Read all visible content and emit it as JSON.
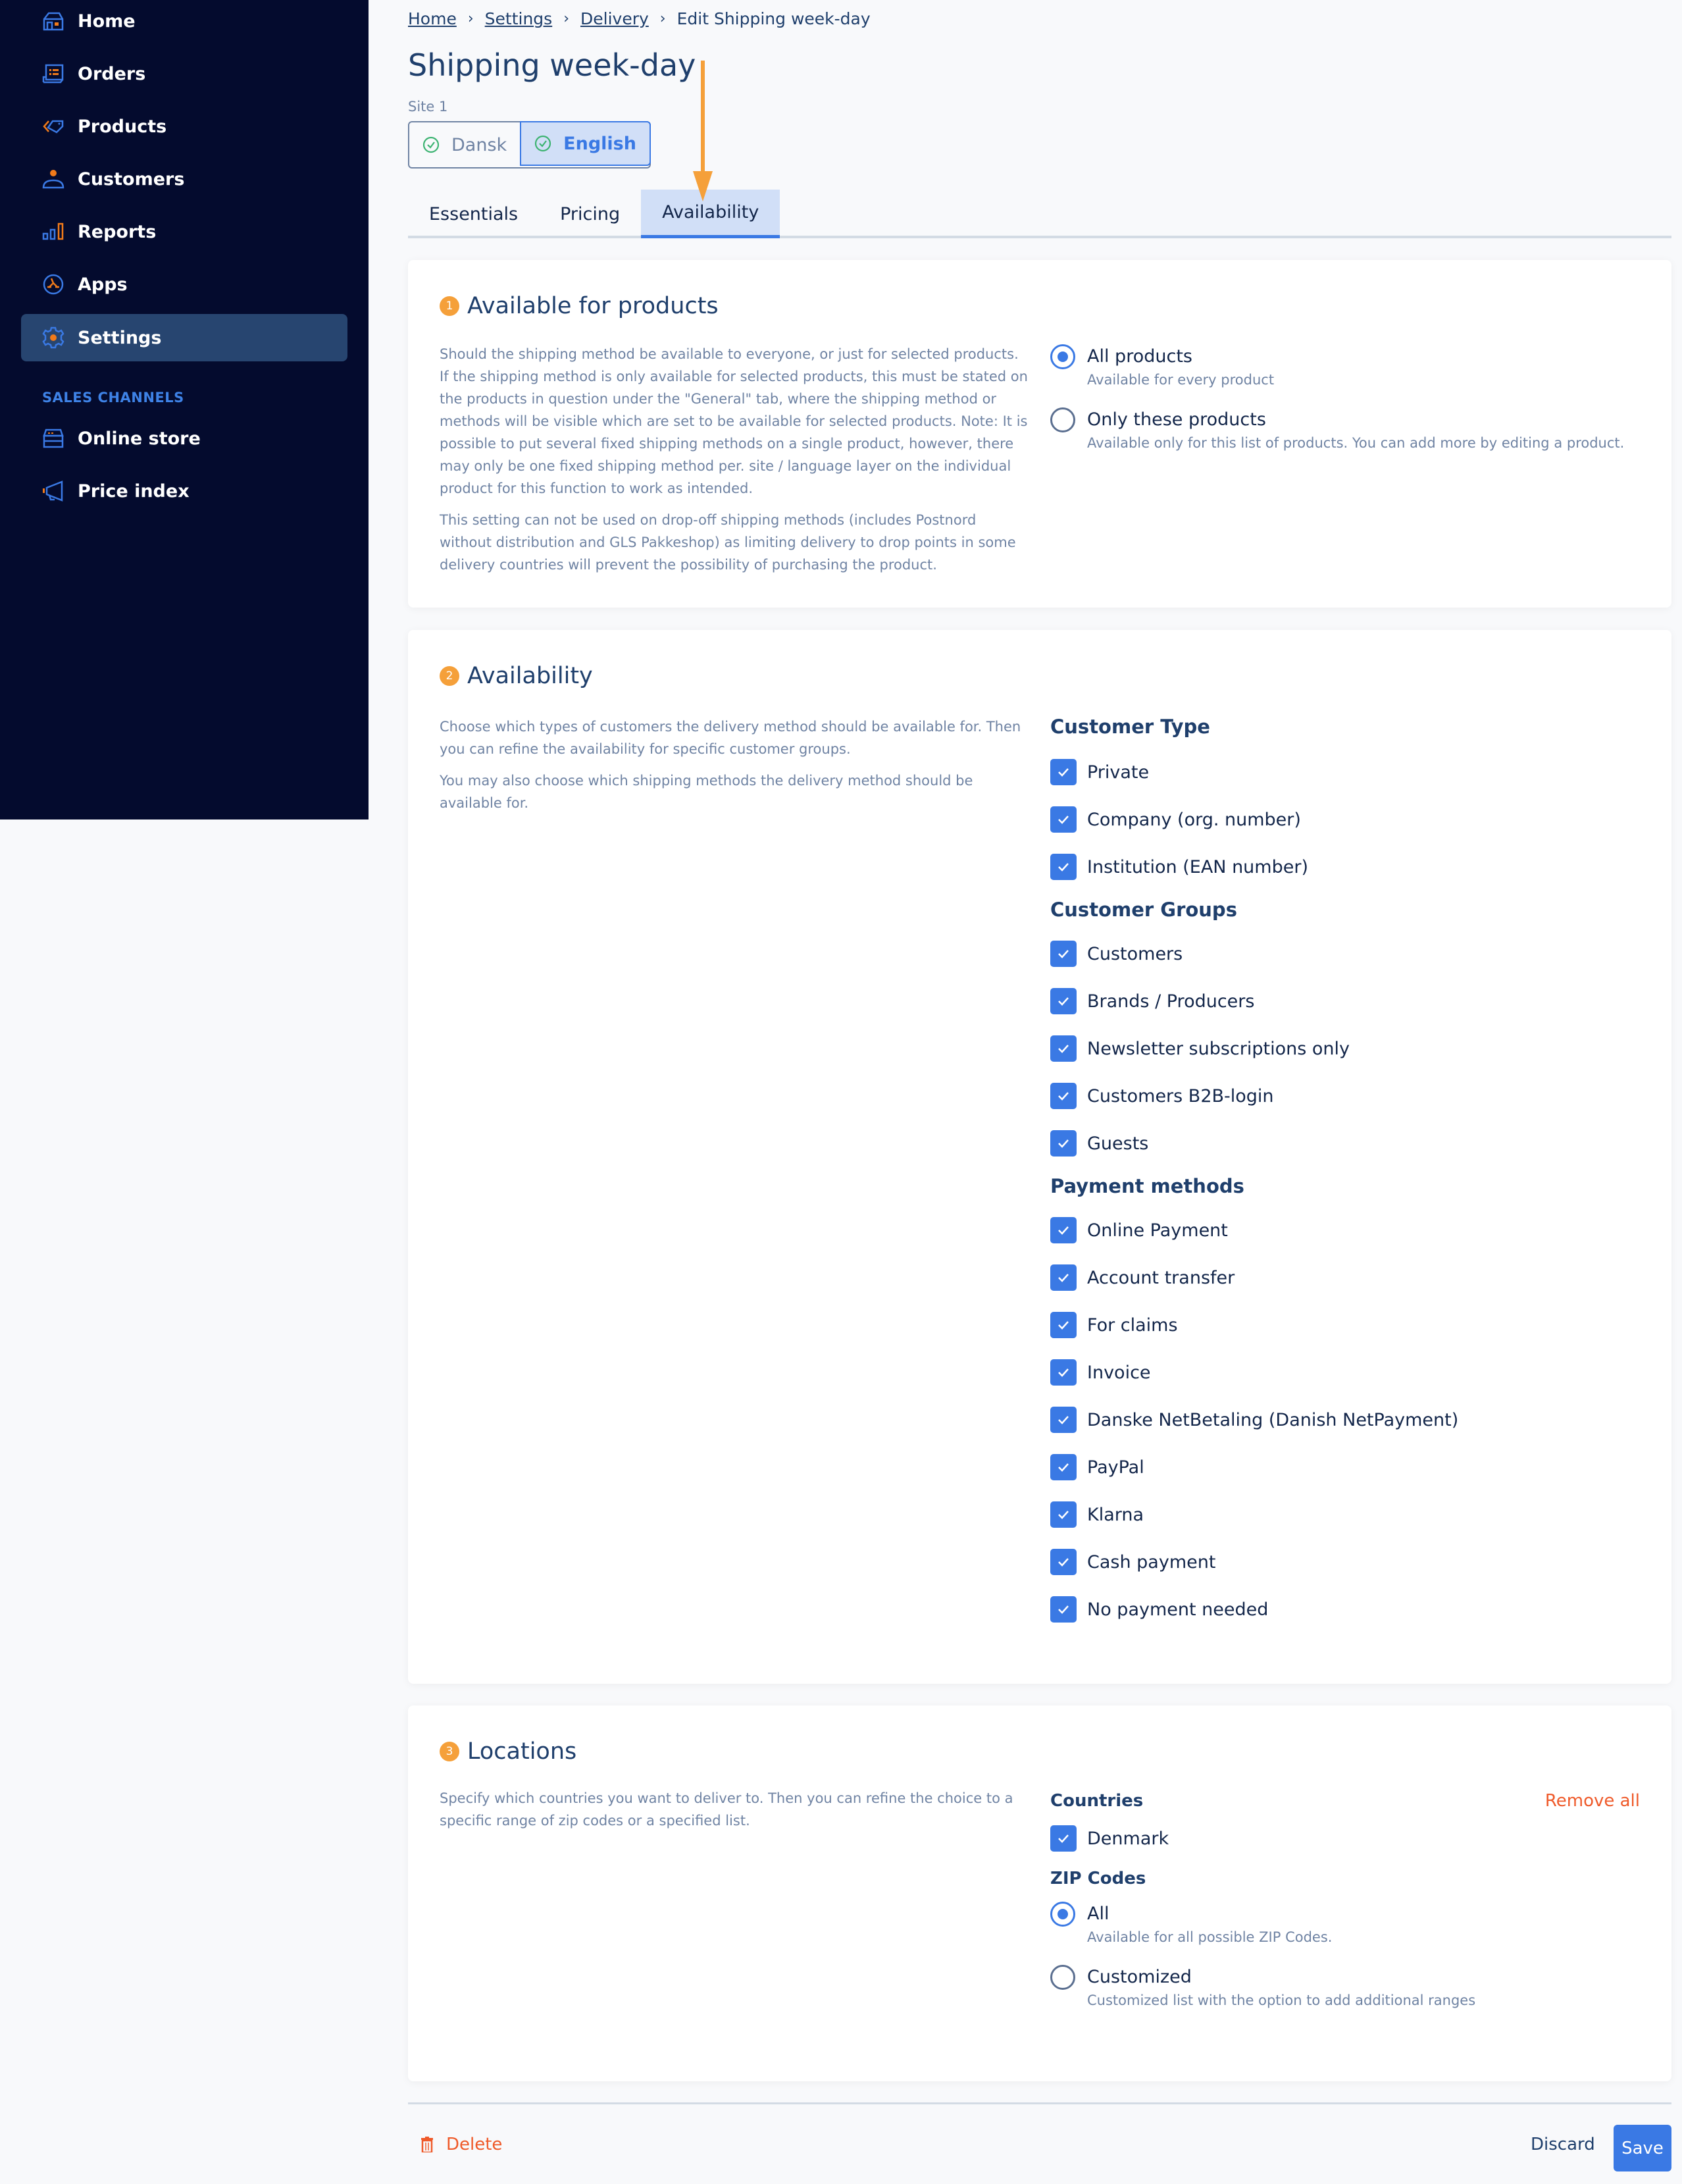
{
  "sidebar": {
    "items": [
      {
        "label": "Home",
        "icon": "home-icon"
      },
      {
        "label": "Orders",
        "icon": "orders-icon"
      },
      {
        "label": "Products",
        "icon": "tag-icon"
      },
      {
        "label": "Customers",
        "icon": "user-icon"
      },
      {
        "label": "Reports",
        "icon": "bar-chart-icon"
      },
      {
        "label": "Apps",
        "icon": "apps-icon"
      },
      {
        "label": "Settings",
        "icon": "gear-icon",
        "active": true
      }
    ],
    "sales_channels_heading": "SALES CHANNELS",
    "sales_channels": [
      {
        "label": "Online store",
        "icon": "store-icon"
      },
      {
        "label": "Price index",
        "icon": "megaphone-icon"
      }
    ]
  },
  "breadcrumb": {
    "items": [
      "Home",
      "Settings",
      "Delivery"
    ],
    "current": "Edit Shipping week-day"
  },
  "header": {
    "title": "Shipping week-day",
    "site_label": "Site 1",
    "languages": [
      {
        "label": "Dansk",
        "active": false
      },
      {
        "label": "English",
        "active": true
      }
    ]
  },
  "tabs": [
    {
      "label": "Essentials",
      "active": false
    },
    {
      "label": "Pricing",
      "active": false
    },
    {
      "label": "Availability",
      "active": true
    }
  ],
  "products_card": {
    "step": "1",
    "title": "Available for products",
    "description": [
      "Should the shipping method be available to everyone, or just for selected products. If the shipping method is only available for selected products, this must be stated on the products in question under the \"General\" tab, where the shipping method or methods will be visible which are set to be available for selected products. Note: It is possible to put several fixed shipping methods on a single product, however, there may only be one fixed shipping method per. site / language layer on the individual product for this function to work as intended.",
      "This setting can not be used on drop-off shipping methods (includes Postnord without distribution and GLS Pakkeshop) as limiting delivery to drop points in some delivery countries will prevent the possibility of purchasing the product."
    ],
    "options": [
      {
        "label": "All products",
        "sub": "Available for every product",
        "checked": true
      },
      {
        "label": "Only these products",
        "sub": "Available only for this list of products. You can add more by editing a product.",
        "checked": false
      }
    ]
  },
  "availability_card": {
    "step": "2",
    "title": "Availability",
    "description": [
      "Choose which types of customers the delivery method should be available for. Then you can refine the availability for specific customer groups.",
      "You may also choose which shipping methods the delivery method should be available for."
    ],
    "customer_type": {
      "heading": "Customer Type",
      "items": [
        {
          "label": "Private",
          "checked": true
        },
        {
          "label": "Company (org. number)",
          "checked": true
        },
        {
          "label": "Institution (EAN number)",
          "checked": true
        }
      ]
    },
    "customer_groups": {
      "heading": "Customer Groups",
      "items": [
        {
          "label": "Customers",
          "checked": true
        },
        {
          "label": "Brands / Producers",
          "checked": true
        },
        {
          "label": "Newsletter subscriptions only",
          "checked": true
        },
        {
          "label": "Customers B2B-login",
          "checked": true
        },
        {
          "label": "Guests",
          "checked": true
        }
      ]
    },
    "payment_methods": {
      "heading": "Payment methods",
      "items": [
        {
          "label": "Online Payment",
          "checked": true
        },
        {
          "label": "Account transfer",
          "checked": true
        },
        {
          "label": "For claims",
          "checked": true
        },
        {
          "label": "Invoice",
          "checked": true
        },
        {
          "label": "Danske NetBetaling (Danish NetPayment)",
          "checked": true
        },
        {
          "label": "PayPal",
          "checked": true
        },
        {
          "label": "Klarna",
          "checked": true
        },
        {
          "label": "Cash payment",
          "checked": true
        },
        {
          "label": "No payment needed",
          "checked": true
        }
      ]
    }
  },
  "locations_card": {
    "step": "3",
    "title": "Locations",
    "description": "Specify which countries you want to deliver to. Then you can refine the choice to a specific range of zip codes or a specified list.",
    "countries_heading": "Countries",
    "remove_all": "Remove all",
    "countries": [
      {
        "label": "Denmark",
        "checked": true
      }
    ],
    "zip_heading": "ZIP Codes",
    "zip_options": [
      {
        "label": "All",
        "sub": "Available for all possible ZIP Codes.",
        "checked": true
      },
      {
        "label": "Customized",
        "sub": "Customized list with the option to add additional ranges",
        "checked": false
      }
    ]
  },
  "footer": {
    "delete": "Delete",
    "discard": "Discard",
    "save": "Save"
  },
  "colors": {
    "sidebar_bg": "#040b2e",
    "accent": "#3a79e4",
    "step_badge": "#f5a03a",
    "danger": "#ef5a2a",
    "annotation_arrow": "#f5a03a"
  }
}
